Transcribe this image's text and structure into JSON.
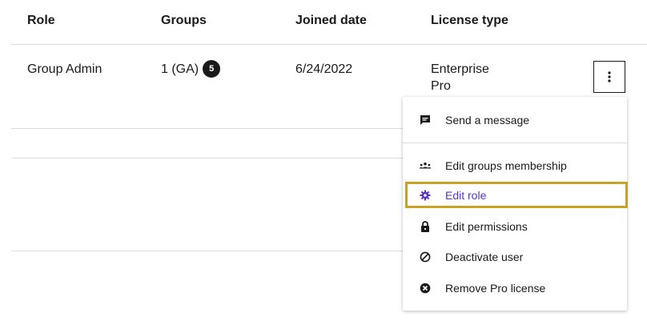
{
  "table": {
    "headers": {
      "role": "Role",
      "groups": "Groups",
      "joined_date": "Joined date",
      "license_type": "License type"
    },
    "row": {
      "role": "Group Admin",
      "groups": "1 (GA)",
      "groups_badge": "5",
      "joined_date": "6/24/2022",
      "license_line1": "Enterprise",
      "license_line2": "Pro"
    }
  },
  "menu": {
    "items": [
      {
        "label": "Send a message",
        "icon": "message-icon"
      },
      {
        "label": "Edit groups membership",
        "icon": "groups-icon"
      },
      {
        "label": "Edit role",
        "icon": "gear-icon",
        "active": true
      },
      {
        "label": "Edit permissions",
        "icon": "lock-icon"
      },
      {
        "label": "Deactivate user",
        "icon": "deactivate-icon"
      },
      {
        "label": "Remove Pro license",
        "icon": "remove-icon"
      }
    ]
  },
  "colors": {
    "text": "#1a1a1a",
    "active": "#5a31c9",
    "highlight": "#c9a227",
    "divider": "#dcdcdc"
  }
}
